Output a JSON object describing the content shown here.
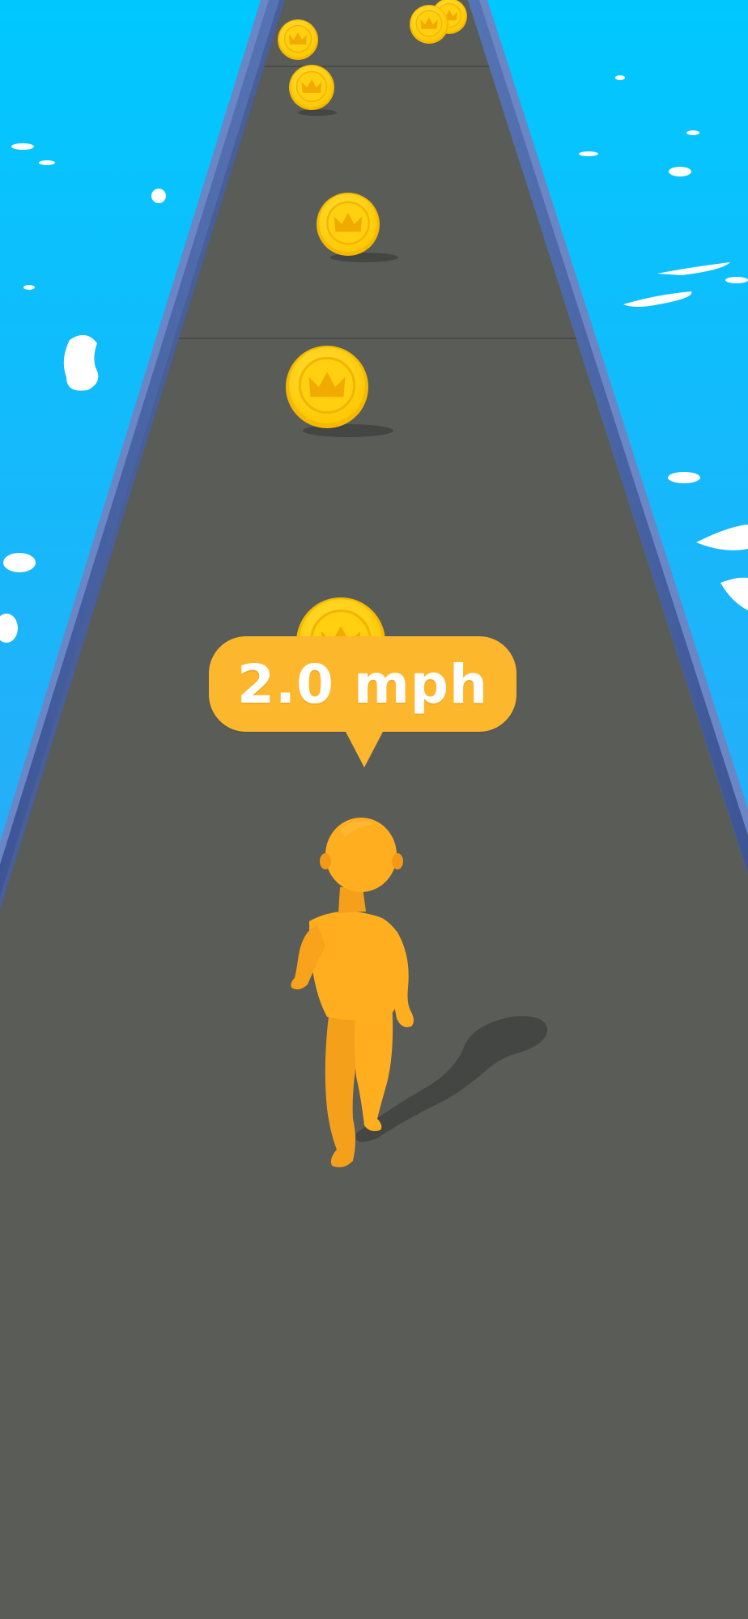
{
  "hud": {
    "speed_label": "2.0 mph"
  },
  "colors": {
    "sky_top": "#00c6ff",
    "sky_bottom": "#3aa0f5",
    "road": "#5a5c58",
    "rail": "#4d6aa6",
    "coin": "#ffd21a",
    "coin_rim": "#f4b400",
    "player": "#ffae1f",
    "bubble": "#fdb72c"
  },
  "scene": {
    "player": "orange-runner-character",
    "collectible": "crown-coin",
    "coin_count_visible": 7
  }
}
